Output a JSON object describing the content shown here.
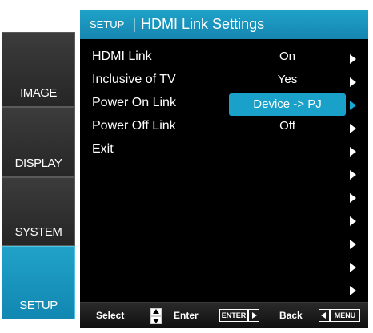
{
  "header": {
    "section": "SETUP",
    "separator": "|",
    "title": "HDMI Link Settings"
  },
  "tabs": [
    {
      "label": "IMAGE",
      "active": false
    },
    {
      "label": "DISPLAY",
      "active": false
    },
    {
      "label": "SYSTEM",
      "active": false
    },
    {
      "label": "SETUP",
      "active": true
    }
  ],
  "settings": [
    {
      "label": "HDMI Link",
      "value": "On"
    },
    {
      "label": "Inclusive of TV",
      "value": "Yes"
    },
    {
      "label": "Power On Link",
      "value": "Device -> PJ",
      "selected": true
    },
    {
      "label": "Power Off Link",
      "value": "Off"
    },
    {
      "label": "Exit",
      "value": ""
    }
  ],
  "footer": {
    "select_label": "Select",
    "enter_label": "Enter",
    "enter_key": "ENTER",
    "back_label": "Back",
    "menu_key": "MENU"
  },
  "colors": {
    "accent": "#1a9fc9",
    "panel_bg": "#000000",
    "text": "#ffffff"
  },
  "icons": [
    "right-arrow-icon",
    "up-down-icon",
    "enter-key-icon",
    "menu-key-icon"
  ]
}
